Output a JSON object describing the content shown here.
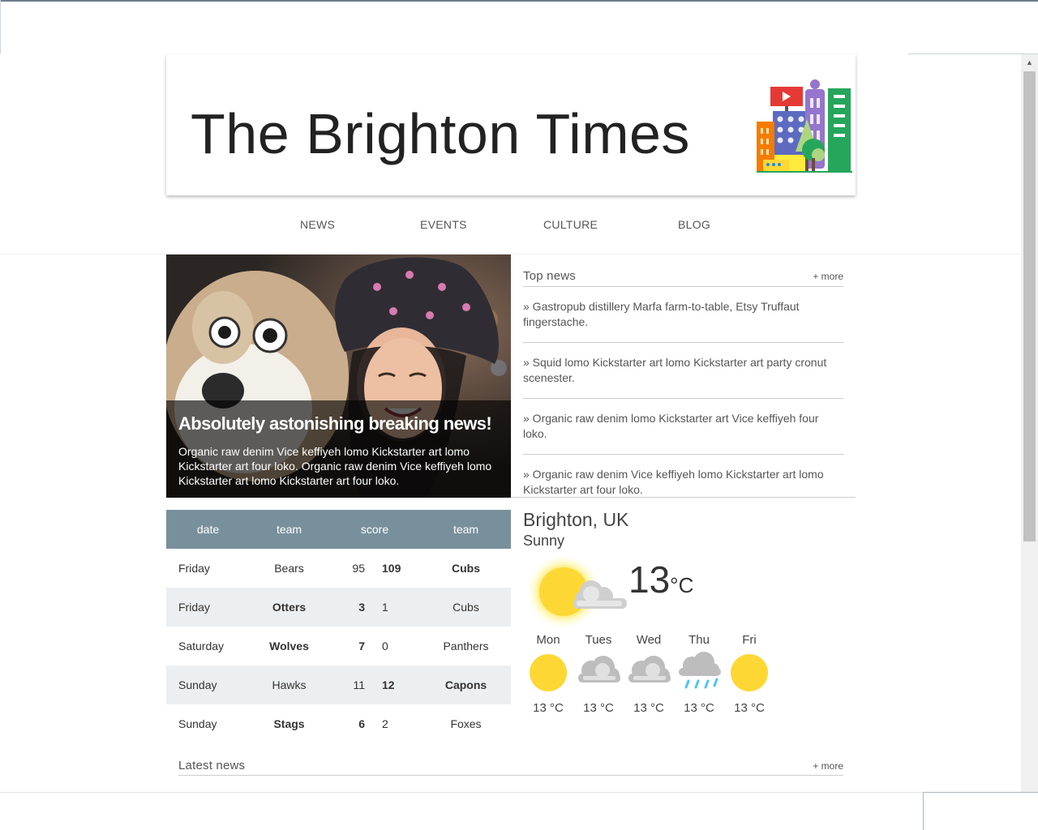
{
  "masthead": {
    "title": "The Brighton Times"
  },
  "nav": {
    "items": [
      "NEWS",
      "EVENTS",
      "CULTURE",
      "BLOG"
    ]
  },
  "hero": {
    "headline": "Absolutely astonishing breaking news!",
    "summary": "Organic raw denim Vice keffiyeh lomo Kickstarter art lomo Kickstarter art four loko. Organic raw denim Vice keffiyeh lomo Kickstarter art lomo Kickstarter art four loko."
  },
  "top_news": {
    "title": "Top news",
    "more": "+ more",
    "items": [
      "» Gastropub distillery Marfa farm-to-table, Etsy Truffaut fingerstache.",
      "» Squid lomo Kickstarter art lomo Kickstarter art party cronut scenester.",
      "» Organic raw denim lomo Kickstarter art Vice keffiyeh four loko.",
      "» Organic raw denim Vice keffiyeh lomo Kickstarter art lomo Kickstarter art four loko."
    ]
  },
  "scores": {
    "headers": [
      "date",
      "team",
      "score",
      "team"
    ],
    "rows": [
      {
        "date": "Friday",
        "team1": "Bears",
        "s1": "95",
        "s2": "109",
        "team2": "Cubs",
        "winner": 2
      },
      {
        "date": "Friday",
        "team1": "Otters",
        "s1": "3",
        "s2": "1",
        "team2": "Cubs",
        "winner": 1
      },
      {
        "date": "Saturday",
        "team1": "Wolves",
        "s1": "7",
        "s2": "0",
        "team2": "Panthers",
        "winner": 1
      },
      {
        "date": "Sunday",
        "team1": "Hawks",
        "s1": "11",
        "s2": "12",
        "team2": "Capons",
        "winner": 2
      },
      {
        "date": "Sunday",
        "team1": "Stags",
        "s1": "6",
        "s2": "2",
        "team2": "Foxes",
        "winner": 1
      }
    ]
  },
  "weather": {
    "location": "Brighton, UK",
    "condition": "Sunny",
    "current_temp": "13",
    "current_unit": "°C",
    "current_icon": "sun-cloud-icon",
    "forecast": [
      {
        "day": "Mon",
        "temp": "13 °C",
        "icon": "sun-icon"
      },
      {
        "day": "Tues",
        "temp": "13 °C",
        "icon": "cloud-icon"
      },
      {
        "day": "Wed",
        "temp": "13 °C",
        "icon": "cloud-icon"
      },
      {
        "day": "Thu",
        "temp": "13 °C",
        "icon": "rain-icon"
      },
      {
        "day": "Fri",
        "temp": "13 °C",
        "icon": "sun-icon"
      }
    ]
  },
  "latest_news": {
    "title": "Latest news",
    "more": "+ more"
  },
  "colors": {
    "table_header": "#78909c",
    "table_stripe": "#eceff1",
    "sun": "#fdd835",
    "cloud": "#bdbdbd",
    "rain": "#4fc3f7"
  }
}
